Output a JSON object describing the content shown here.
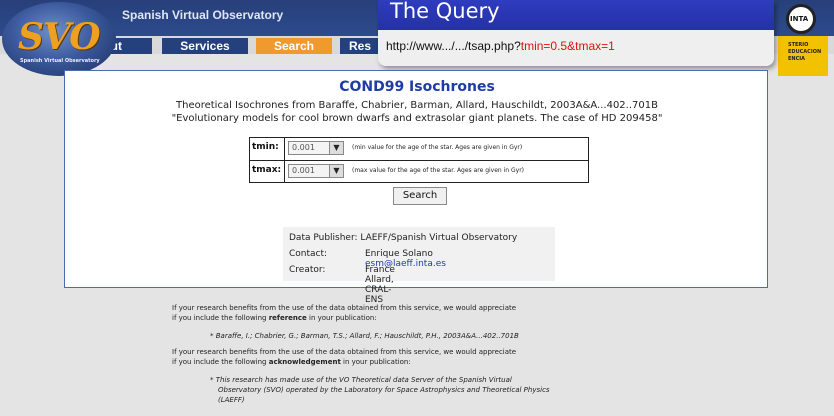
{
  "header": {
    "site_title": "Spanish Virtual Observatory",
    "logo_text": "SVO",
    "logo_subtitle": "Spanish Virtual Observatory",
    "inta_label": "INTA",
    "ministerio_lines": [
      "STERIO",
      "EDUCACION",
      "ENCIA"
    ]
  },
  "nav": {
    "logout": "gout",
    "services": "Services",
    "search": "Search",
    "results": "Res"
  },
  "query_overlay": {
    "title": "The Query",
    "url_prefix": "http://www.../.../tsap.php?",
    "url_params": "tmin=0.5&tmax=1"
  },
  "panel": {
    "title": "COND99 Isochrones",
    "line1": "Theoretical Isochrones from Baraffe, Chabrier, Barman, Allard, Hauschildt, 2003A&A...402..701B",
    "line2": "\"Evolutionary models for cool brown dwarfs and extrasolar giant planets. The case of HD 209458\""
  },
  "form": {
    "tmin_label": "tmin:",
    "tmin_value": "0.001",
    "tmin_hint": "(min value for the age of the star. Ages are given in Gyr)",
    "tmax_label": "tmax:",
    "tmax_value": "0.001",
    "tmax_hint": "(max value for the age of the star. Ages are given in Gyr)",
    "search_label": "Search"
  },
  "publisher": {
    "publisher_line": "Data Publisher: LAEFF/Spanish Virtual Observatory",
    "contact_label": "Contact:",
    "contact_name": "Enrique Solano",
    "contact_email": "esm@laeff.inta.es",
    "creator_label": "Creator:",
    "creator_name": "France Allard, CRAL-ENS"
  },
  "footer": {
    "p1a": "If your research benefits from the use of the data obtained from this service, we would appreciate",
    "p1b_pre": "if you include the following ",
    "p1b_bold": "reference",
    "p1b_post": " in your publication:",
    "ref": "* Baraffe, I.; Chabrier, G.; Barman, T.S.; Allard, F.; Hauschildt, P.H., 2003A&A...402..701B",
    "p2a": "If your research benefits from the use of the data obtained from this service, we would appreciate",
    "p2b_pre": "if you include the following ",
    "p2b_bold": "acknowledgement",
    "p2b_post": " in your publication:",
    "ack1": "* This research has made use of the VO Theoretical data Server of the Spanish Virtual",
    "ack2": "Observatory (SVO) operated by the Laboratory for Space Astrophysics and Theoretical Physics",
    "ack3": "(LAEFF)"
  }
}
